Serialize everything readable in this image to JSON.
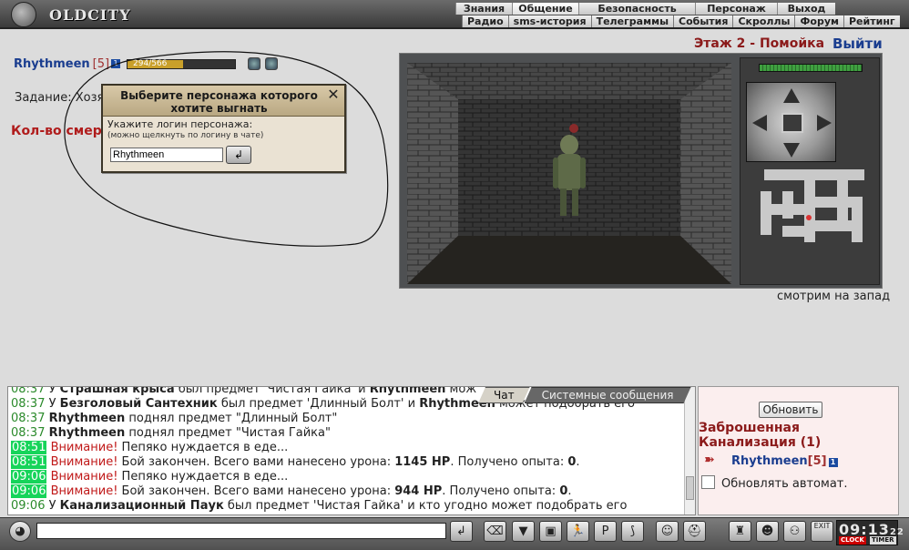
{
  "app": {
    "logo_text": "OLDCITY"
  },
  "top_menu": {
    "row1": [
      "Знания",
      "Общение",
      "Безопасность",
      "Персонаж",
      "Выход"
    ],
    "row2": [
      "Радио",
      "sms-история",
      "Телеграммы",
      "События",
      "Скроллы",
      "Форум",
      "Рейтинг"
    ]
  },
  "player": {
    "name": "Rhythmeen",
    "level": "[5]",
    "badge": "1",
    "hp_text": "294/566",
    "hp_fraction": 0.52
  },
  "task_text": "Задание: Хозяй",
  "deaths_text": "Кол-во смерт",
  "location_header": {
    "floor": "Этаж 2 - Помойка",
    "exit": "Выйти"
  },
  "dialog": {
    "title": "Выберите персонажа которого хотите выгнать",
    "close_glyph": "✕",
    "label": "Укажите логин персонажа:",
    "hint": "(можно щелкнуть по логину в чате)",
    "input_value": "Rhythmeen",
    "submit_glyph": "↲"
  },
  "view": {
    "direction_text": "смотрим на запад"
  },
  "chat": {
    "tabs": [
      "Чат",
      "Системные сообщения"
    ],
    "lines": [
      {
        "time": "08:37",
        "hi": false,
        "parts": [
          [
            "",
            "У "
          ],
          [
            "b",
            "Страшная крыса"
          ],
          [
            "",
            " был предмет 'Чистая Гайка' и "
          ],
          [
            "b",
            "Rhythmeen"
          ],
          [
            "",
            " мож"
          ]
        ]
      },
      {
        "time": "08:37",
        "hi": false,
        "parts": [
          [
            "",
            "У "
          ],
          [
            "b",
            "Безголовый Сантехник"
          ],
          [
            "",
            " был предмет 'Длинный Болт' и "
          ],
          [
            "b",
            "Rhythmeen"
          ],
          [
            "",
            " может подобрать его"
          ]
        ]
      },
      {
        "time": "08:37",
        "hi": false,
        "parts": [
          [
            "b",
            "Rhythmeen"
          ],
          [
            "",
            " поднял предмет \"Длинный Болт\""
          ]
        ]
      },
      {
        "time": "08:37",
        "hi": false,
        "parts": [
          [
            "b",
            "Rhythmeen"
          ],
          [
            "",
            " поднял предмет \"Чистая Гайка\""
          ]
        ]
      },
      {
        "time": "08:51",
        "hi": true,
        "parts": [
          [
            "warn",
            "Внимание!"
          ],
          [
            "",
            " Пепяко нуждается в еде..."
          ]
        ]
      },
      {
        "time": "08:51",
        "hi": true,
        "parts": [
          [
            "warn",
            "Внимание!"
          ],
          [
            "",
            " Бой закончен. Всего вами нанесено урона: "
          ],
          [
            "b",
            "1145 HP"
          ],
          [
            "",
            ". Получено опыта: "
          ],
          [
            "b",
            "0"
          ],
          [
            "",
            "."
          ]
        ]
      },
      {
        "time": "09:06",
        "hi": true,
        "parts": [
          [
            "warn",
            "Внимание!"
          ],
          [
            "",
            " Пепяко нуждается в еде..."
          ]
        ]
      },
      {
        "time": "09:06",
        "hi": true,
        "parts": [
          [
            "warn",
            "Внимание!"
          ],
          [
            "",
            " Бой закончен. Всего вами нанесено урона: "
          ],
          [
            "b",
            "944 HP"
          ],
          [
            "",
            ". Получено опыта: "
          ],
          [
            "b",
            "0"
          ],
          [
            "",
            "."
          ]
        ]
      },
      {
        "time": "09:06",
        "hi": false,
        "parts": [
          [
            "",
            "У "
          ],
          [
            "b",
            "Канализационный Паук"
          ],
          [
            "",
            " был предмет 'Чистая Гайка' и кто угодно может подобрать его"
          ]
        ]
      }
    ]
  },
  "location_panel": {
    "refresh_label": "Обновить",
    "location_name": "Заброшенная Канализация (1)",
    "player_name": "Rhythmeen",
    "player_level": "[5]",
    "player_badge": "1",
    "auto_refresh_label": "Обновлять автомат."
  },
  "bottom_bar": {
    "chat_input_value": "",
    "clock_time": "09:13",
    "clock_seconds": "22",
    "clock_label": "CLOCK",
    "timer_label": "TIMER",
    "exit_label": "EXIT"
  },
  "colors": {
    "accent_red": "#8b1a1a",
    "accent_blue": "#1a3d8f",
    "time_highlight": "#16d45a"
  }
}
